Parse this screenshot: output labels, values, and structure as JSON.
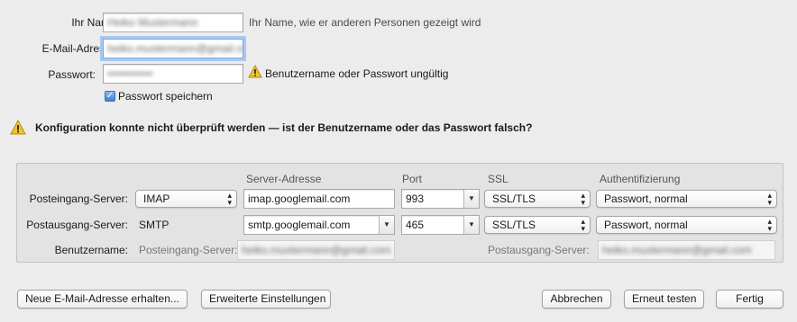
{
  "account": {
    "name_label": "Ihr Name:",
    "name_value": "Heiko Mustermann",
    "name_hint": "Ihr Name, wie er anderen Personen gezeigt wird",
    "email_label": "E-Mail-Adresse:",
    "email_value": "heiko.mustermann@gmail.com",
    "password_label": "Passwort:",
    "password_value": "••••••••••••",
    "password_warning": "Benutzername oder Passwort ungültig",
    "remember_label": "Passwort speichern",
    "remember_checked": true
  },
  "config_warning": "Konfiguration konnte nicht überprüft werden — ist der Benutzername oder das Passwort falsch?",
  "server_table": {
    "headers": {
      "address": "Server-Adresse",
      "port": "Port",
      "ssl": "SSL",
      "auth": "Authentifizierung"
    },
    "incoming": {
      "label": "Posteingang-Server:",
      "protocol": "IMAP",
      "address": "imap.googlemail.com",
      "port": "993",
      "ssl": "SSL/TLS",
      "auth": "Passwort, normal"
    },
    "outgoing": {
      "label": "Postausgang-Server:",
      "protocol": "SMTP",
      "address": "smtp.googlemail.com",
      "port": "465",
      "ssl": "SSL/TLS",
      "auth": "Passwort, normal"
    },
    "username": {
      "label": "Benutzername:",
      "incoming_label": "Posteingang-Server:",
      "incoming_value": "heiko.mustermann@gmail.com",
      "outgoing_label": "Postausgang-Server:",
      "outgoing_value": "heiko.mustermann@gmail.com"
    }
  },
  "buttons": {
    "new_address": "Neue E-Mail-Adresse erhalten...",
    "advanced": "Erweiterte Einstellungen",
    "cancel": "Abbrechen",
    "retest": "Erneut testen",
    "done": "Fertig"
  },
  "icons": {
    "warning": "warning-triangle-icon",
    "popup_arrows": "updown-arrows-icon",
    "combo_arrow": "chevron-down-icon"
  },
  "colors": {
    "warning_fill": "#f2c230",
    "focus_ring": "#a9c8f0",
    "checkbox": "#3f7fd6"
  }
}
